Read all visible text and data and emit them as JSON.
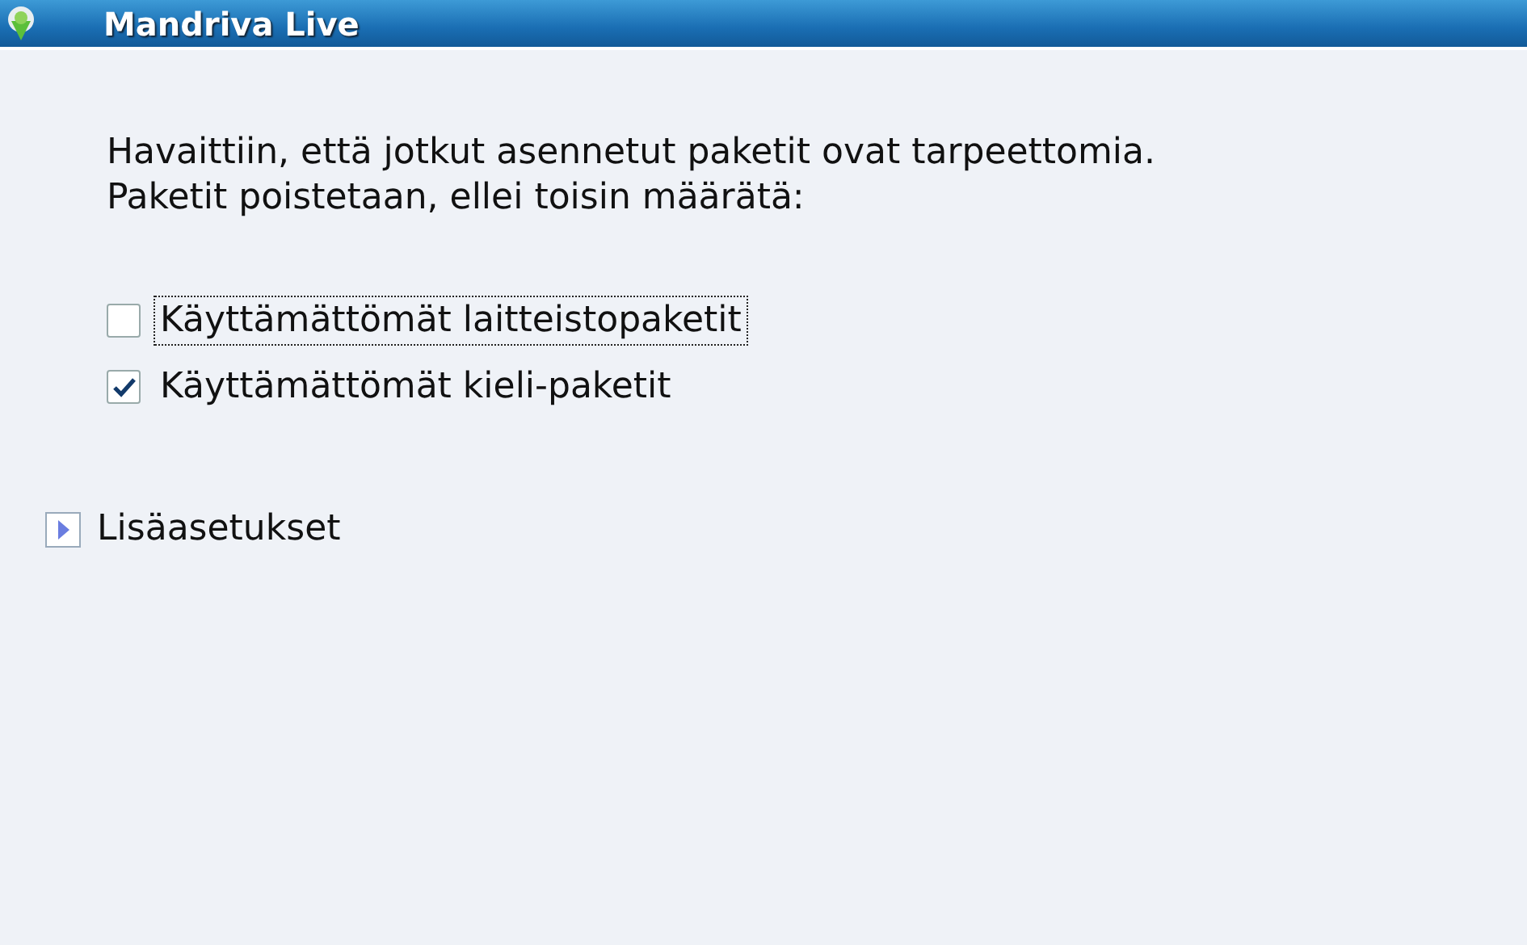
{
  "window": {
    "title": "Mandriva Live"
  },
  "message": "Havaittiin, että jotkut asennetut paketit ovat tarpeettomia.\nPaketit poistetaan, ellei toisin määrätä:",
  "options": [
    {
      "label": "Käyttämättömät laitteistopaketit",
      "checked": false,
      "focused": true
    },
    {
      "label": "Käyttämättömät kieli-paketit",
      "checked": true,
      "focused": false
    }
  ],
  "expander": {
    "label": "Lisäasetukset",
    "expanded": false
  }
}
